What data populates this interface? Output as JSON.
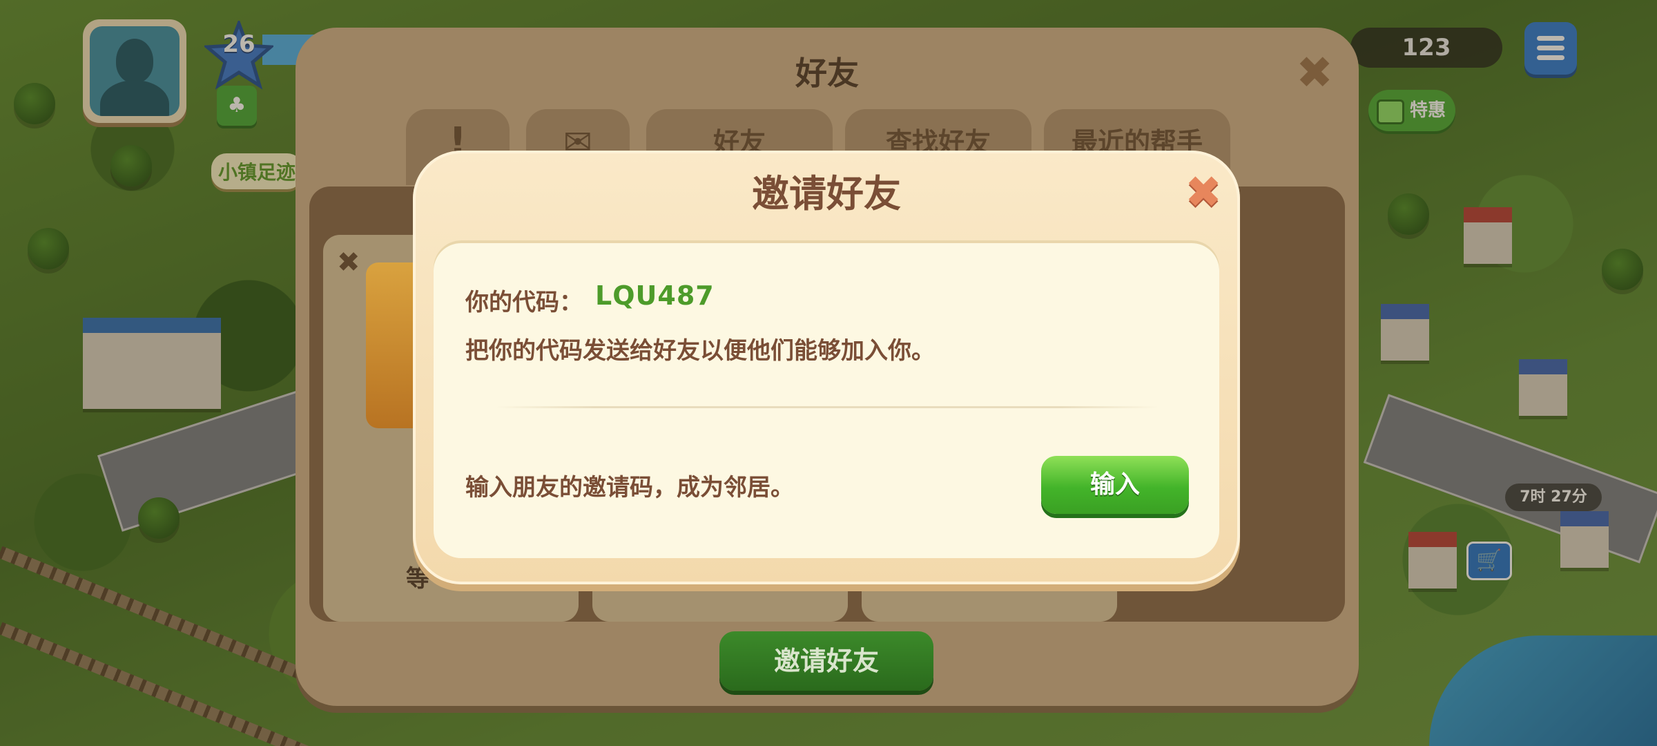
{
  "hud": {
    "level": "26",
    "coins": "123",
    "offer_label": "特惠",
    "footprint_label": "小镇足迹",
    "timer": "7时 27分"
  },
  "friends_panel": {
    "title": "好友",
    "tabs": [
      "",
      "",
      "好友",
      "查找好友",
      "最近的帮手"
    ],
    "card_text": "等",
    "invite_button": "邀请好友"
  },
  "invite_dialog": {
    "title": "邀请好友",
    "code_label": "你的代码：",
    "code_value": "LQU487",
    "code_hint": "把你的代码发送给好友以便他们能够加入你。",
    "enter_hint": "输入朋友的邀请码，成为邻居。",
    "enter_button": "输入"
  },
  "colors": {
    "code_green": "#4d9b2a",
    "title_brown": "#7a4e36",
    "enter_button_green": "#43b42a"
  }
}
